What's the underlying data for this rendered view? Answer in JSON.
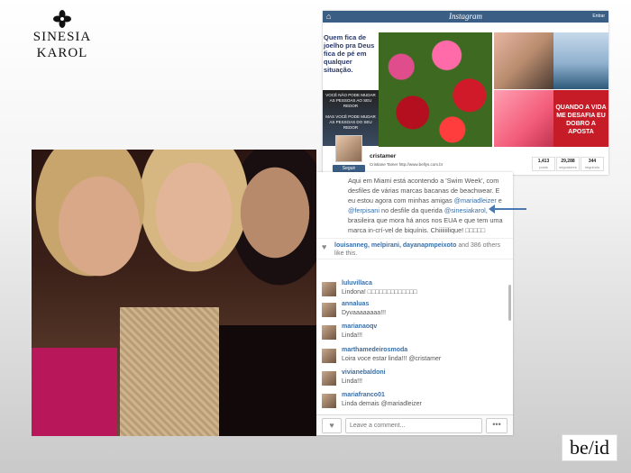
{
  "logo": {
    "brand_name": "SINESIA KAROL"
  },
  "instagram_profile": {
    "home_icon": "home-icon",
    "brand": "Instagram",
    "user_label": "Entrar",
    "tiles": {
      "quote_text": "Quem fica de joelho pra Deus fica de pé em qualquer situação.",
      "speech_text_1": "VOCÊ NÃO PODE MUDAR AS PESSOAS AO SEU REDOR",
      "speech_text_2": "MAS VOCÊ PODE MUDAR AS PESSOAS DO SEU REDOR",
      "challenge_text": "QUANDO A VIDA ME DESAFIA EU DOBRO A APOSTA"
    },
    "follow_label": "Seguir",
    "username": "cristamer",
    "bio": "Cristiane Tamer  http://www.bellys.com.br",
    "stats": [
      {
        "value": "1,413",
        "label": "posts"
      },
      {
        "value": "29,288",
        "label": "seguidores"
      },
      {
        "value": "344",
        "label": "seguindo"
      }
    ]
  },
  "post": {
    "caption_1": "Aqui em Miami está acontendo a 'Swim Week', com desfiles de várias marcas bacanas de beachwear. E eu estou agora com minhas amigas ",
    "mention_1": "@mariadleizer",
    "caption_2": " e ",
    "mention_2": "@ferpisani",
    "caption_3": " no desfile da querida ",
    "mention_3": "@sinesiakarol",
    "caption_4": ", brasileira que mora há anos nos EUA e que tem uma marca in-crí-vel de biquínis. Chiiiiiilique! □□□□□",
    "likes_users": "louisanneg, melpirani, dayanapmpeixoto",
    "likes_and": " and ",
    "likes_count": "386",
    "likes_suffix": " others like this.",
    "comments": [
      {
        "user": "luluvillaca",
        "text": "Lindona! □□□□□□□□□□□□□"
      },
      {
        "user": "annaluas",
        "text": "Dyvaaaaaaaa!!!"
      },
      {
        "user": "marianaoqv",
        "text": "Linda!!!"
      },
      {
        "user": "marthamedeirosmoda",
        "text": "Loira voce estar linda!!! @cristamer"
      },
      {
        "user": "vivianebaldoni",
        "text": "Linda!!!"
      },
      {
        "user": "mariafranco01",
        "text": "Linda demais @mariadleizer"
      }
    ],
    "comment_placeholder": "Leave a comment...",
    "like_icon": "heart-icon",
    "more_label": "•••"
  },
  "footer_logo": {
    "text": "be/id"
  }
}
